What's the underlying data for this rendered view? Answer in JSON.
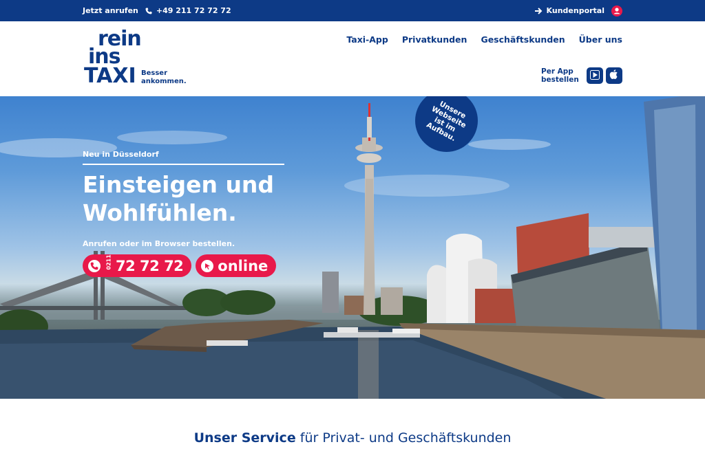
{
  "topbar": {
    "call_label": "Jetzt anrufen",
    "phone": "+49 211 72 72 72",
    "portal_label": "Kundenportal"
  },
  "logo": {
    "line1": "rein",
    "line2": "ins",
    "line3": "TAXI",
    "tagline": "Besser ankommen."
  },
  "nav": {
    "items": [
      "Taxi-App",
      "Privatkunden",
      "Geschäftskunden",
      "Über uns"
    ]
  },
  "app": {
    "label": "Per App bestellen"
  },
  "badge": {
    "text": "Unsere Webseite ist im Aufbau."
  },
  "hero": {
    "kicker": "Neu in Düsseldorf",
    "headline_line1": "Einsteigen und",
    "headline_line2": "Wohlfühlen.",
    "subline": "Anrufen oder im Browser bestellen.",
    "cta_phone_area": "0211",
    "cta_phone_number": "72 72 72",
    "cta_online": "online"
  },
  "service": {
    "title_bold": "Unser Service",
    "title_rest": "für Privat- und Geschäftskunden"
  },
  "colors": {
    "brand_blue": "#0d3a86",
    "accent_red": "#e8194a"
  }
}
